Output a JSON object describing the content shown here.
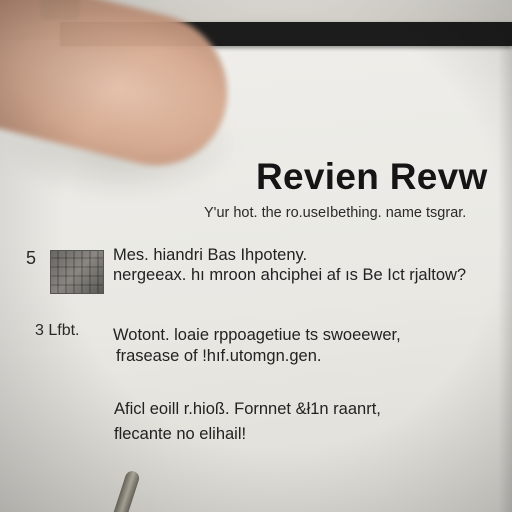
{
  "document": {
    "title": "Revien Revw",
    "subtitle": "Y'ur hot. the ro.useIbething. name tsgrar.",
    "items": [
      {
        "number": "5",
        "lines": [
          "Mes. hiandri Bas Ihpoteny.",
          "nergeeax. hı mroon ahciphei af ıs Be Ict rjaltow?"
        ]
      },
      {
        "number": "3 Lfbt.",
        "lines": [
          "Wotont. loaie rppoagetiue ts swoeewer,",
          "frasease of !hıf.utomgn.gen."
        ]
      },
      {
        "number": "",
        "lines": [
          "Aficl eoill r.hioß. Fornnet &ł1n raanrt,",
          "flecante no elihail!"
        ]
      }
    ]
  },
  "colors": {
    "paper": "#ecebe6",
    "ink": "#1e1e1e",
    "frame": "#1c1c1c",
    "skin": "#d6a98f",
    "teal": "#2f7e66"
  }
}
